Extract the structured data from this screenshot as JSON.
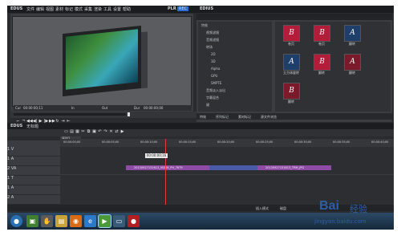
{
  "window": {
    "app_name": "EDUS",
    "player_label": "PLR",
    "player_mode": "REC",
    "right_app": "EDIUS"
  },
  "menu": [
    "文件",
    "编辑",
    "视图",
    "素材",
    "标记",
    "模式",
    "采集",
    "渲染",
    "工具",
    "设置",
    "帮助"
  ],
  "player": {
    "cur_label": "Cur",
    "cur_tc": "00:00:00;11",
    "in_label": "In",
    "out_label": "Out",
    "dur_label": "Dur",
    "dur_tc": "00:00:00;00"
  },
  "right_panel": {
    "tree": [
      "特效",
      "视频滤镜",
      "音频滤镜",
      "转场",
      "2D",
      "3D",
      "Alpha",
      "GPU",
      "SMPTE",
      "音频淡入淡出",
      "字幕混合",
      "键"
    ],
    "effects": [
      {
        "glyph": "B",
        "label": "卷页",
        "color": "#b31d3a"
      },
      {
        "glyph": "B",
        "label": "卷页",
        "color": "#b31d3a"
      },
      {
        "glyph": "A",
        "label": "翻转",
        "color": "#1f3f6b"
      },
      {
        "glyph": "B",
        "label": "",
        "color": "#b31d3a"
      },
      {
        "glyph": "B",
        "label": "",
        "color": "#b31d3a"
      },
      {
        "glyph": "B",
        "label": "",
        "color": "#b31d3a"
      },
      {
        "glyph": "A",
        "label": "立方体旋转",
        "color": "#1f3f6b"
      },
      {
        "glyph": "B",
        "label": "翻转",
        "color": "#b31d3a"
      },
      {
        "glyph": "A",
        "label": "翻转",
        "color": "#7a1a2b"
      },
      {
        "glyph": "B",
        "label": "翻转",
        "color": "#7a1a2b"
      }
    ],
    "tabs": [
      "特效",
      "序列标记",
      "素材标记",
      "源文件浏览"
    ]
  },
  "timeline": {
    "title": "EDUS",
    "project": "无标题",
    "sequence_tab": "序列1",
    "ruler": [
      "00:00:00;00",
      "00:00:05;00",
      "00:00:10;00",
      "00:00:15;00",
      "00:00:20;00",
      "00:00:25;00",
      "00:00:30;00",
      "00:00:35;00",
      "00:00:40;00"
    ],
    "cursor_tc": "00:00:00;16",
    "tracks": [
      "1 V",
      "1 A",
      "2 VA",
      "1 T",
      "1 A",
      "2 A"
    ],
    "clips": [
      "20130927131613_VID08_PH_7879",
      "20130927131613_TRM_JPG"
    ],
    "status": [
      "插入模式",
      "磁盘"
    ]
  },
  "taskbar": {
    "buttons": [
      {
        "name": "start",
        "glyph": "●",
        "color": "#2a6fb2"
      },
      {
        "name": "folder",
        "glyph": "▣",
        "color": "#3f7f2f"
      },
      {
        "name": "media",
        "glyph": "✋",
        "color": "#5a5a5a"
      },
      {
        "name": "explorer",
        "glyph": "▤",
        "color": "#c9a23a"
      },
      {
        "name": "firefox",
        "glyph": "◉",
        "color": "#d96b17"
      },
      {
        "name": "ie",
        "glyph": "e",
        "color": "#2c78c9"
      },
      {
        "name": "edius",
        "glyph": "▶",
        "color": "#4a9a3a"
      },
      {
        "name": "window",
        "glyph": "▭",
        "color": "#3a5a7a"
      },
      {
        "name": "record",
        "glyph": "●",
        "color": "#b02020"
      }
    ]
  },
  "watermark": {
    "brand": "Bai",
    "suffix": "经验",
    "url": "jingyan.baidu.com"
  }
}
